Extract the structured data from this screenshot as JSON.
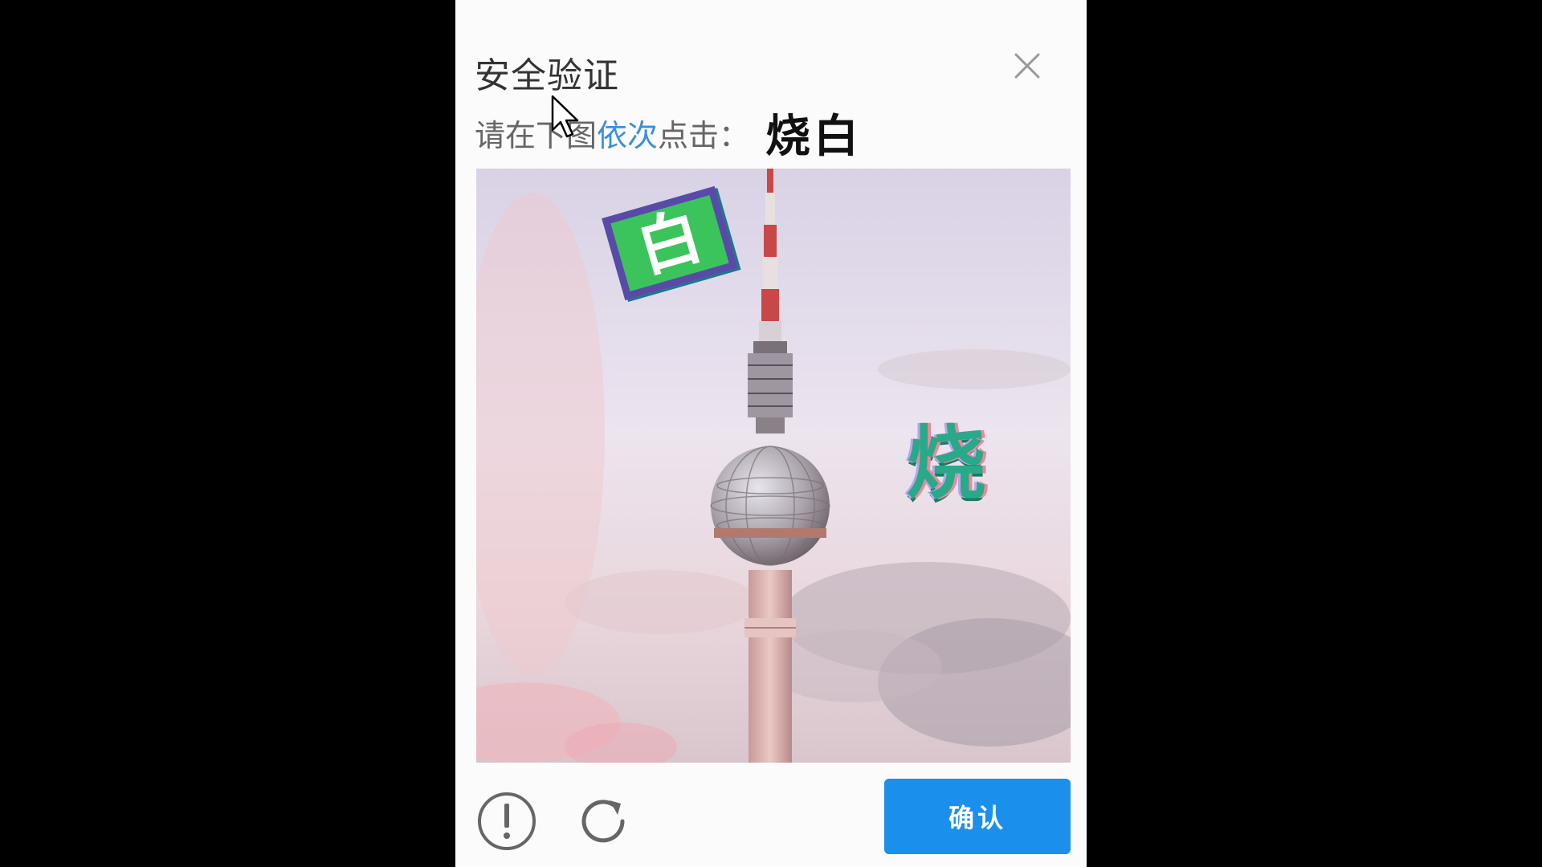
{
  "dialog": {
    "title": "安全验证",
    "close_icon": "close-icon"
  },
  "instruction": {
    "prefix": "请在下图",
    "highlight": "依次",
    "suffix": "点击：",
    "target_chars": "烧白"
  },
  "captcha": {
    "image_subject": "tower-photo",
    "glyphs": [
      {
        "char": "白"
      },
      {
        "char": "烧"
      }
    ]
  },
  "footer": {
    "report_icon": "exclamation-circle-icon",
    "refresh_icon": "refresh-icon",
    "confirm_label": "确认"
  },
  "colors": {
    "backdrop": "#000000",
    "dialog_bg": "#fbfbfb",
    "highlight": "#3d8fd9",
    "confirm_bg": "#1a8fec"
  }
}
